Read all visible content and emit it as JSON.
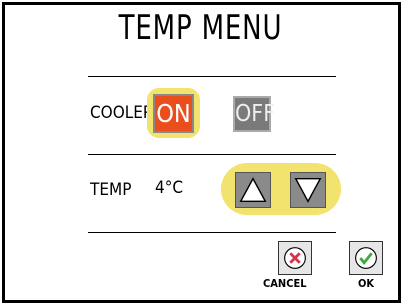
{
  "title": "TEMP MENU",
  "cooler": {
    "label": "COOLER",
    "on_label": "ON",
    "off_label": "OFF",
    "selected": "ON"
  },
  "temp": {
    "label": "TEMP",
    "value": "4°C"
  },
  "buttons": {
    "cancel": "CANCEL",
    "ok": "OK"
  },
  "icons": {
    "up": "triangle-up-icon",
    "down": "triangle-down-icon",
    "cancel": "x-circle-icon",
    "ok": "check-circle-icon"
  },
  "colors": {
    "on": "#ea4e1d",
    "off": "#7a7a7a",
    "highlight": "#f2e26e",
    "cancel_icon": "#d9334a",
    "ok_icon": "#3daa3a"
  }
}
